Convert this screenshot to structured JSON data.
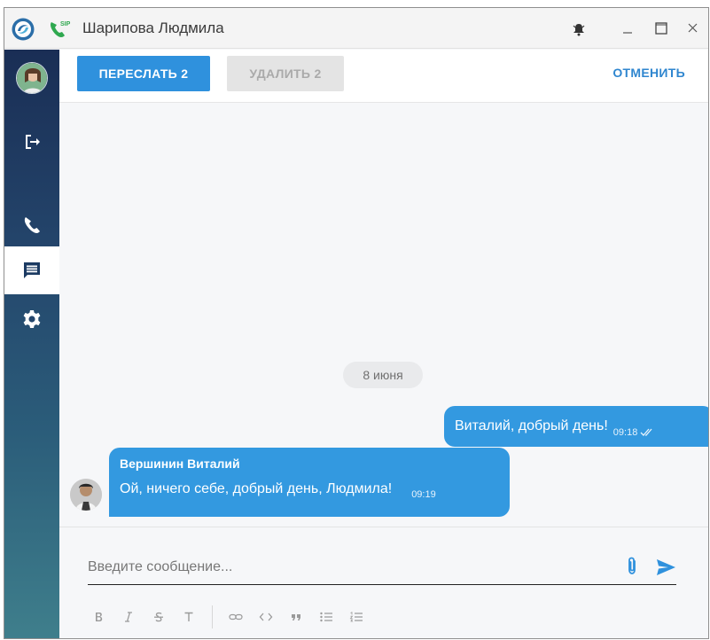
{
  "window": {
    "title": "Шарипова Людмила",
    "sip_badge": "SIP"
  },
  "actions": {
    "forward_label": "ПЕРЕСЛАТЬ 2",
    "delete_label": "УДАЛИТЬ 2",
    "cancel_label": "ОТМЕНИТЬ"
  },
  "chat": {
    "date_divider": "8 июня",
    "messages": [
      {
        "direction": "outgoing",
        "text": "Виталий, добрый день!",
        "time": "09:18",
        "status": "read"
      },
      {
        "direction": "incoming",
        "sender": "Вершинин Виталий",
        "text": "Ой, ничего себе, добрый день, Людмила!",
        "time": "09:19"
      }
    ]
  },
  "composer": {
    "placeholder": "Введите сообщение...",
    "format_buttons": [
      "B",
      "I",
      "S",
      "T",
      "link",
      "code",
      "quote",
      "bulleted-list",
      "numbered-list"
    ]
  },
  "colors": {
    "accent": "#2f91dd",
    "bubble": "#3399e0",
    "sidebar_top": "#1a2e55",
    "sidebar_bottom": "#3f7f8c"
  }
}
